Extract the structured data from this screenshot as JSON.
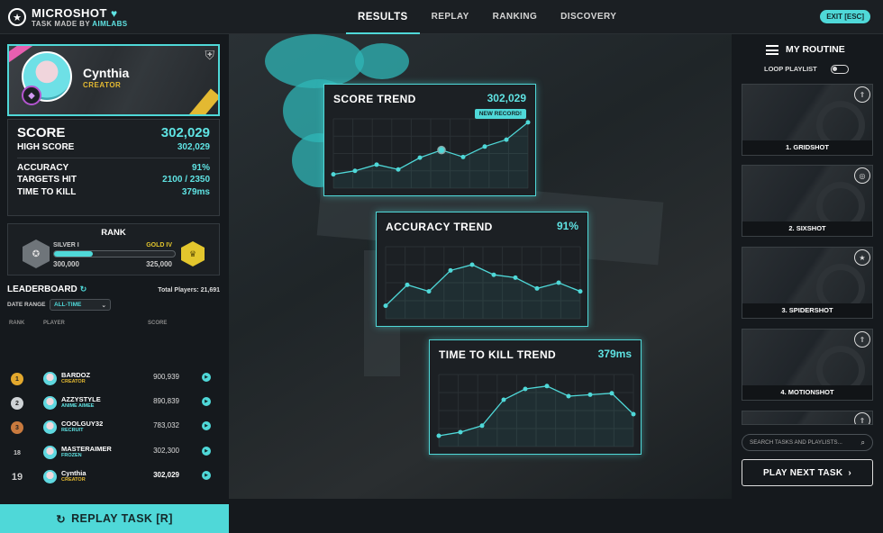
{
  "app": {
    "name": "MICROSHOT",
    "subtitle_prefix": "TASK MADE BY",
    "subtitle_brand": "AIMLABS"
  },
  "nav": {
    "tabs": [
      "RESULTS",
      "REPLAY",
      "RANKING",
      "DISCOVERY"
    ],
    "active": "RESULTS"
  },
  "exit_label": "EXIT [ESC]",
  "profile": {
    "name": "Cynthia",
    "role": "CREATOR"
  },
  "stats": {
    "score_label": "SCORE",
    "score": "302,029",
    "high_score_label": "HIGH SCORE",
    "high_score": "302,029",
    "accuracy_label": "ACCURACY",
    "accuracy": "91%",
    "targets_label": "TARGETS HIT",
    "targets": "2100 / 2350",
    "ttk_label": "TIME TO KILL",
    "ttk": "379ms"
  },
  "rank": {
    "title": "RANK",
    "current": "SILVER I",
    "next": "GOLD IV",
    "current_pts": "300,000",
    "next_pts": "325,000",
    "progress": 0.32
  },
  "leaderboard": {
    "title": "LEADERBOARD",
    "total": "Total Players: 21,691",
    "date_range_label": "DATE RANGE",
    "date_range": "ALL-TIME",
    "headers": {
      "rank": "RANK",
      "player": "PLAYER",
      "score": "SCORE"
    },
    "rows": [
      {
        "rank": "1",
        "name": "BARDOZ",
        "role": "CREATOR",
        "score": "900,939",
        "medal": "#e3a82d",
        "role_color": "#e3b932"
      },
      {
        "rank": "2",
        "name": "AZZYSTYLE",
        "role": "ANIME AIMEE",
        "score": "890,839",
        "medal": "#cfd3d6",
        "role_color": "#5fe3e3"
      },
      {
        "rank": "3",
        "name": "COOLGUY32",
        "role": "RECRUIT",
        "score": "783,032",
        "medal": "#c97a3e",
        "role_color": "#5fe3e3"
      },
      {
        "rank": "18",
        "name": "MASTERAIMER",
        "role": "FROZEN",
        "score": "302,300",
        "medal": "",
        "role_color": "#5fe3e3"
      },
      {
        "rank": "19",
        "name": "Cynthia",
        "role": "CREATOR",
        "score": "302,029",
        "medal": "",
        "role_color": "#e3b932"
      }
    ]
  },
  "replay_label": "REPLAY TASK [R]",
  "trends": [
    {
      "title": "SCORE TREND",
      "value": "302,029",
      "badge": "NEW RECORD!",
      "points": [
        0.2,
        0.25,
        0.34,
        0.27,
        0.44,
        0.55,
        0.45,
        0.6,
        0.7,
        0.95
      ],
      "highlight": 5
    },
    {
      "title": "ACCURACY TREND",
      "value": "91%",
      "points": [
        0.18,
        0.47,
        0.38,
        0.67,
        0.75,
        0.61,
        0.57,
        0.42,
        0.5,
        0.38
      ]
    },
    {
      "title": "TIME TO KILL TREND",
      "value": "379ms",
      "points": [
        0.15,
        0.2,
        0.29,
        0.65,
        0.8,
        0.84,
        0.7,
        0.72,
        0.74,
        0.45
      ]
    }
  ],
  "routine": {
    "title": "MY ROUTINE",
    "loop_label": "LOOP PLAYLIST",
    "tasks": [
      {
        "label": "1. GRIDSHOT",
        "icon": "chevrons-up-icon"
      },
      {
        "label": "2. SIXSHOT",
        "icon": "target-icon"
      },
      {
        "label": "3. SPIDERSHOT",
        "icon": "star-icon"
      },
      {
        "label": "4. MOTIONSHOT",
        "icon": "chevrons-up-icon"
      }
    ],
    "search_placeholder": "SEARCH TASKS AND PLAYLISTS...",
    "play_next": "PLAY NEXT TASK"
  },
  "colors": {
    "accent": "#4fd8d8",
    "gold": "#e3b932"
  }
}
